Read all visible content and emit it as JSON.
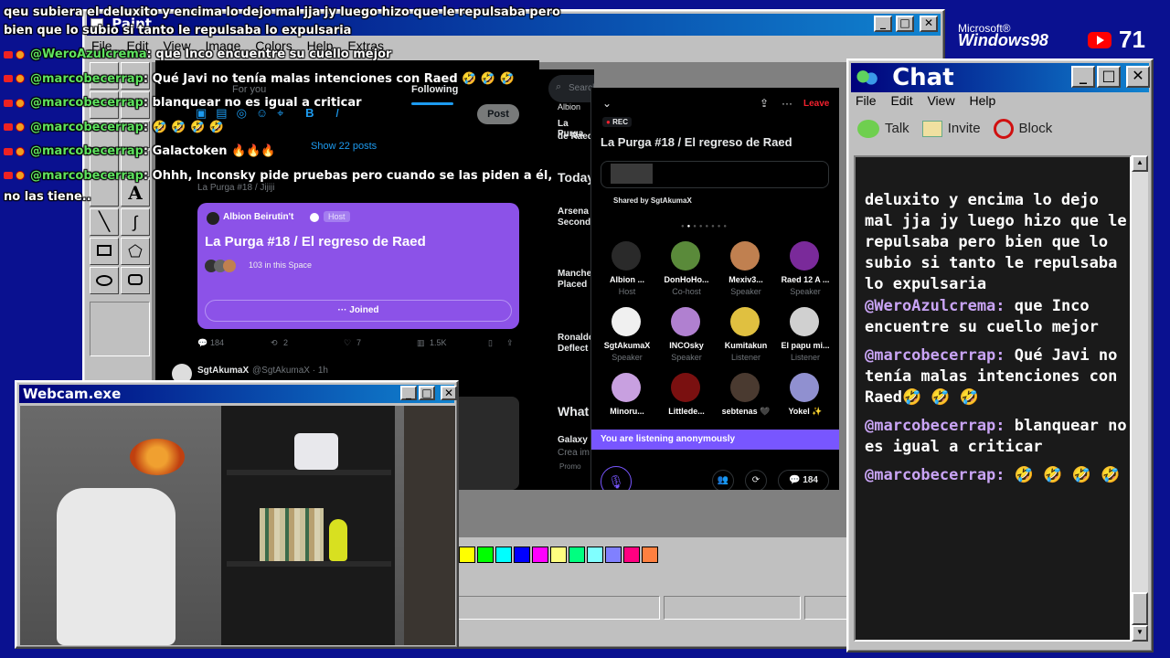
{
  "branding": {
    "ms": "Microsoft®",
    "windows": "Windows98",
    "yt_count": "71"
  },
  "paint": {
    "title": "Paint",
    "menu": [
      "File",
      "Edit",
      "View",
      "Image",
      "Colors",
      "Help",
      "Extras"
    ],
    "palette": [
      "#ffff00",
      "#00ff00",
      "#00ffff",
      "#0000ff",
      "#ff00ff",
      "#ffff80",
      "#00ff80",
      "#80ffff",
      "#8080ff",
      "#ff0080",
      "#ff8040"
    ]
  },
  "overlay": {
    "line1": "qeu subiera el deluxito y encima lo dejo mal jja jy luego hizo que le repulsaba pero",
    "line2": "bien que lo subio si tanto le repulsaba lo expulsaria",
    "msgs": [
      {
        "user": "@WeroAzulcrema",
        "text": ": que Inco encuentre su cuello mejor"
      },
      {
        "user": "@marcobecerrap",
        "text": ": Qué Javi no tenía malas intenciones con Raed 🤣 🤣 🤣"
      },
      {
        "user": "@marcobecerrap",
        "text": ": blanquear no es igual a criticar"
      },
      {
        "user": "@marcobecerrap",
        "text": ": 🤣 🤣 🤣 🤣"
      },
      {
        "user": "@marcobecerrap",
        "text": ": Galactoken 🔥🔥🔥"
      },
      {
        "user": "@marcobecerrap",
        "text": ": Ohhh, Inconsky pide pruebas pero cuando se las piden a él,"
      }
    ],
    "cont": "no las tiene.."
  },
  "twitter": {
    "tabs": {
      "for_you": "For you",
      "following": "Following"
    },
    "post": "Post",
    "show_posts": "Show 22 posts",
    "search": "Search",
    "reply_to": "La Purga #18 / Jijiji",
    "space_card": {
      "host": "Albion Beirutin't",
      "host_badge": "Host",
      "title": "La Purga #18 / El regreso de Raed",
      "count": "103 in this Space",
      "joined": "Joined"
    },
    "actions": {
      "replies": "184",
      "retweets": "2",
      "likes": "7",
      "views": "1.5K"
    },
    "tweet2": {
      "name": "SgtAkumaX",
      "handle": "@SgtAkumaX · 1h"
    },
    "sidebar": {
      "today": "Today",
      "what": "What",
      "items": [
        "Arsena",
        "Second",
        "Manche",
        "Placed",
        "Ronaldo",
        "Deflect",
        "Galaxy",
        "Crea im",
        "Promo"
      ],
      "top": "Albion",
      "top2": "La Purga",
      "top3": "de Raed"
    }
  },
  "space": {
    "rec": "REC",
    "leave": "Leave",
    "title": "La Purga #18 / El regreso de Raed",
    "shared": "Shared by SgtAkumaX",
    "people": [
      {
        "name": "Albion ...",
        "role": "Host",
        "color": "#2a2a2a"
      },
      {
        "name": "DonHoHo...",
        "role": "Co-host",
        "color": "#5a8a3a"
      },
      {
        "name": "Mexiv3...",
        "role": "Speaker",
        "color": "#c08050"
      },
      {
        "name": "Raed 12 A ...",
        "role": "Speaker",
        "color": "#7a2a9a"
      },
      {
        "name": "SgtAkumaX",
        "role": "Speaker",
        "color": "#f0f0f0"
      },
      {
        "name": "INCOsky",
        "role": "Speaker",
        "color": "#b080d0"
      },
      {
        "name": "Kumitakun",
        "role": "Listener",
        "color": "#e0c040"
      },
      {
        "name": "El papu mi...",
        "role": "Listener",
        "color": "#d0d0d0"
      },
      {
        "name": "Minoru...",
        "role": "",
        "color": "#c8a0e0"
      },
      {
        "name": "Littlede...",
        "role": "",
        "color": "#7a1010"
      },
      {
        "name": "sebtenas 🖤",
        "role": "",
        "color": "#4a3a30"
      },
      {
        "name": "Yokel ✨",
        "role": "",
        "color": "#9090d0"
      }
    ],
    "listening": "You are listening anonymously",
    "replies": "184"
  },
  "webcam": {
    "title": "Webcam.exe"
  },
  "chat": {
    "title": "Chat",
    "menu": [
      "File",
      "Edit",
      "View",
      "Help"
    ],
    "toolbar": {
      "talk": "Talk",
      "invite": "Invite",
      "block": "Block"
    },
    "msg0": "deluxito y encima lo dejo mal jja jy luego hizo que le repulsaba pero bien que lo subio si tanto le repulsaba lo expulsaria",
    "msgs": [
      {
        "user": "@WeroAzulcrema:",
        "text": " que Inco encuentre su cuello mejor"
      },
      {
        "user": "@marcobecerrap:",
        "text": " Qué Javi no tenía malas intenciones con Raed🤣 🤣 🤣"
      },
      {
        "user": "@marcobecerrap:",
        "text": " blanquear no es igual a criticar"
      },
      {
        "user": "@marcobecerrap:",
        "text": " 🤣 🤣 🤣 🤣"
      }
    ]
  }
}
